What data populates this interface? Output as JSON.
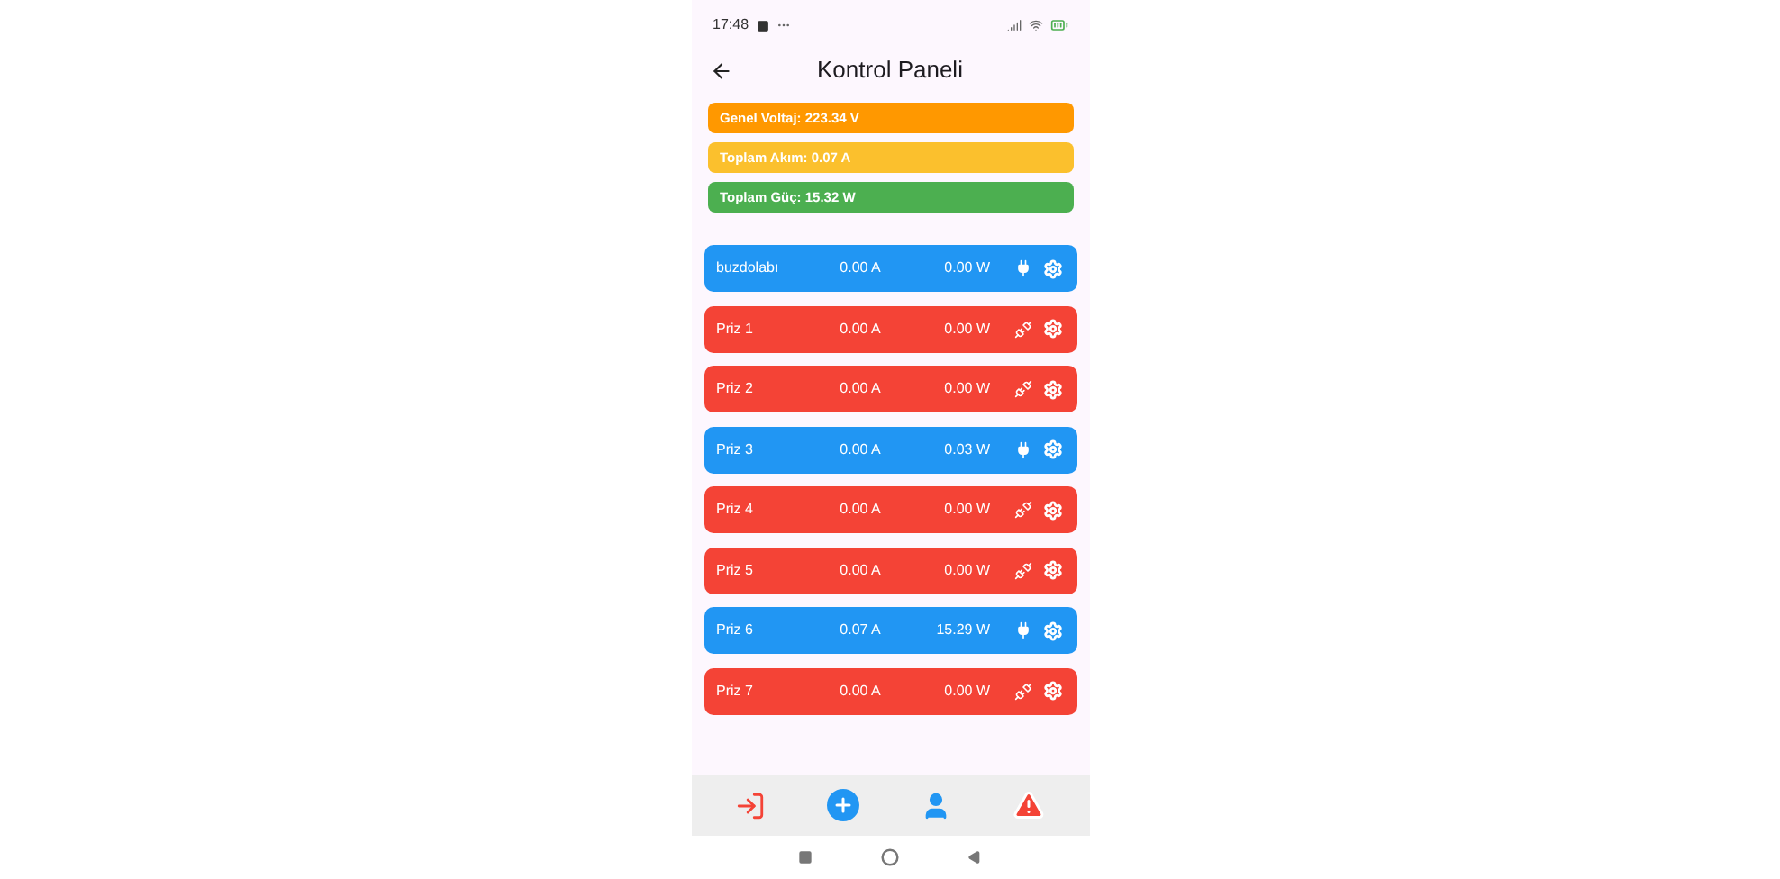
{
  "status_bar": {
    "time": "17:48"
  },
  "app_bar": {
    "title": "Kontrol Paneli"
  },
  "summary": [
    {
      "text": "Genel Voltaj: 223.34 V",
      "color": "#ff9800"
    },
    {
      "text": "Toplam Akım: 0.07 A",
      "color": "#fbc02d"
    },
    {
      "text": "Toplam Güç: 15.32 W",
      "color": "#4caf50"
    }
  ],
  "devices": [
    {
      "name": "buzdolabı",
      "current": "0.00 A",
      "power": "0.00 W",
      "on": true
    },
    {
      "name": "Priz 1",
      "current": "0.00 A",
      "power": "0.00 W",
      "on": false
    },
    {
      "name": "Priz 2",
      "current": "0.00 A",
      "power": "0.00 W",
      "on": false
    },
    {
      "name": "Priz 3",
      "current": "0.00 A",
      "power": "0.03 W",
      "on": true
    },
    {
      "name": "Priz 4",
      "current": "0.00 A",
      "power": "0.00 W",
      "on": false
    },
    {
      "name": "Priz 5",
      "current": "0.00 A",
      "power": "0.00 W",
      "on": false
    },
    {
      "name": "Priz 6",
      "current": "0.07 A",
      "power": "15.29 W",
      "on": true
    },
    {
      "name": "Priz 7",
      "current": "0.00 A",
      "power": "0.00 W",
      "on": false
    }
  ]
}
